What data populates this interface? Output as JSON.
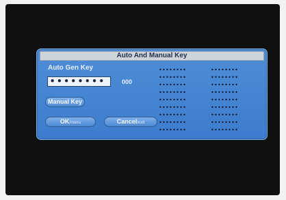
{
  "dialog": {
    "title": "Auto And Manual Key",
    "auto_gen_label": "Auto Gen Key",
    "key_value": "••••••••",
    "key_number": "000",
    "manual_key_label": "Manual Key",
    "ok_label": "OK",
    "ok_hint": "/menu",
    "cancel_label": "Cancel",
    "cancel_hint": "/exit"
  },
  "key_grid": {
    "columns": 2,
    "rows": 9,
    "cell_text": "••••••••"
  },
  "colors": {
    "dialog_blue": "#4f8ed6",
    "title_bar": "#cfd3da",
    "screen_background": "#101010"
  }
}
